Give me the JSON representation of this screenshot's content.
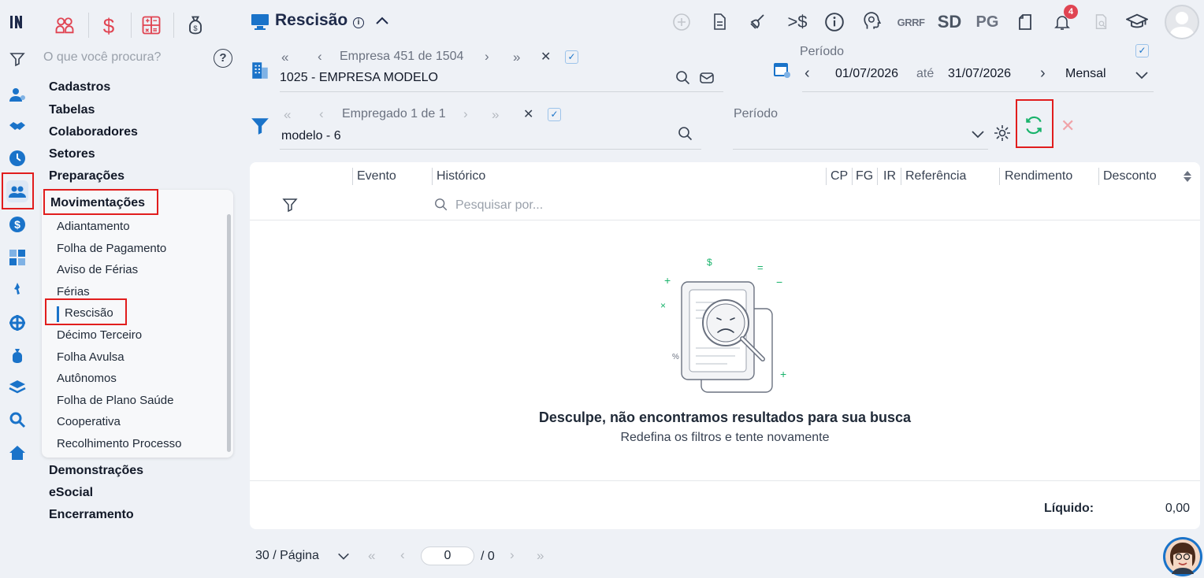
{
  "top_modules": [
    "people-icon",
    "dollar-icon",
    "calculator-icon",
    "money-bag-icon"
  ],
  "search": {
    "placeholder": "O que você procura?"
  },
  "menu": {
    "cadastros": "Cadastros",
    "tabelas": "Tabelas",
    "colaboradores": "Colaboradores",
    "setores": "Setores",
    "preparacoes": "Preparações",
    "movimentacoes": "Movimentações",
    "sub": [
      "Adiantamento",
      "Folha de Pagamento",
      "Aviso de Férias",
      "Férias",
      "Rescisão",
      "Décimo Terceiro",
      "Folha Avulsa",
      "Autônomos",
      "Folha de Plano Saúde",
      "Cooperativa",
      "Recolhimento Processo"
    ],
    "demonstracoes": "Demonstrações",
    "esocial": "eSocial",
    "encerramento": "Encerramento"
  },
  "page": {
    "title": "Rescisão"
  },
  "toolbar": {
    "grrf": "GRRF",
    "sd": "SD",
    "pg": "PG",
    "notifications": "4",
    "currency_arrow": ">$"
  },
  "empresa": {
    "nav": "Empresa 451 de 1504",
    "value": "1025 - EMPRESA MODELO"
  },
  "periodo": {
    "label": "Período",
    "start": "01/07/2026",
    "ate": "até",
    "end": "31/07/2026",
    "mode": "Mensal"
  },
  "empregado": {
    "nav": "Empregado 1 de 1",
    "value": "modelo - 6"
  },
  "periodo2": {
    "label": "Período"
  },
  "table": {
    "headers": {
      "evento": "Evento",
      "historico": "Histórico",
      "cp": "CP",
      "fg": "FG",
      "ir": "IR",
      "referencia": "Referência",
      "rendimento": "Rendimento",
      "desconto": "Desconto"
    },
    "search_placeholder": "Pesquisar por...",
    "empty_title": "Desculpe, não encontramos resultados para sua busca",
    "empty_sub": "Redefina os filtros e tente novamente",
    "liquido_label": "Líquido:",
    "liquido_value": "0,00"
  },
  "pagination": {
    "per_page": "30 / Página",
    "current": "0",
    "total": "/ 0"
  },
  "colors": {
    "accent_blue": "#1a73c9",
    "red_highlight": "#e11d1d",
    "green_refresh": "#19b36b"
  }
}
